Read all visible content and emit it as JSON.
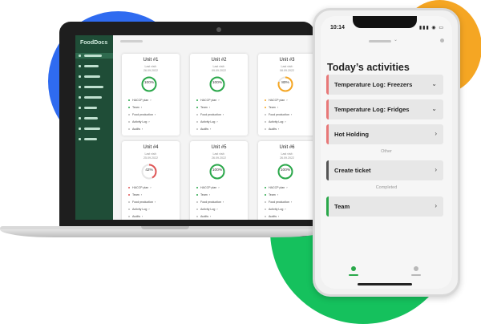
{
  "colors": {
    "brand_green": "#1f4d37",
    "accent_green": "#2aa84a",
    "warning_orange": "#f5a623",
    "alert_red": "#e05555",
    "blob_blue": "#2f6bf0",
    "blob_green": "#15c15d"
  },
  "laptop": {
    "brand": "FoodDocs",
    "sidebar_item_count": 9,
    "units": [
      {
        "title": "Unit #1",
        "last_visit_label": "Last visit:",
        "date": "26.09.2022",
        "percent": "100%",
        "progress": 1.0,
        "status": "ok"
      },
      {
        "title": "Unit #2",
        "last_visit_label": "Last visit:",
        "date": "09.09.2022",
        "percent": "100%",
        "progress": 1.0,
        "status": "ok"
      },
      {
        "title": "Unit #3",
        "last_visit_label": "Last visit:",
        "date": "08.09.2022",
        "percent": "80%",
        "progress": 0.8,
        "status": "warning"
      },
      {
        "title": "Unit #4",
        "last_visit_label": "Last visit:",
        "date": "25.09.2022",
        "percent": "42%",
        "progress": 0.42,
        "status": "alert"
      },
      {
        "title": "Unit #5",
        "last_visit_label": "Last visit:",
        "date": "26.09.2022",
        "percent": "100%",
        "progress": 1.0,
        "status": "ok"
      },
      {
        "title": "Unit #6",
        "last_visit_label": "Last visit:",
        "date": "26.09.2022",
        "percent": "100%",
        "progress": 1.0,
        "status": "ok"
      }
    ],
    "card_links": [
      "HACCP plan",
      "Team",
      "Food production",
      "Activity Log",
      "Audits"
    ]
  },
  "phone": {
    "time": "10:14",
    "status_icons": "▮▮▮ ◉ ▭",
    "title": "Today’s activities",
    "activities": [
      {
        "label": "Temperature Log: Freezers",
        "chevron": "⌄",
        "stripe": "#e87878"
      },
      {
        "label": "Temperature Log: Fridges",
        "chevron": "⌄",
        "stripe": "#e87878"
      },
      {
        "label": "Hot Holding",
        "chevron": "›",
        "stripe": "#e87878"
      }
    ],
    "other_label": "Other",
    "other_items": [
      {
        "label": "Create ticket",
        "chevron": "›",
        "stripe": "#555555"
      }
    ],
    "completed_label": "Completed",
    "completed_items": [
      {
        "label": "Team",
        "chevron": "›",
        "stripe": "#2aa84a"
      }
    ]
  }
}
